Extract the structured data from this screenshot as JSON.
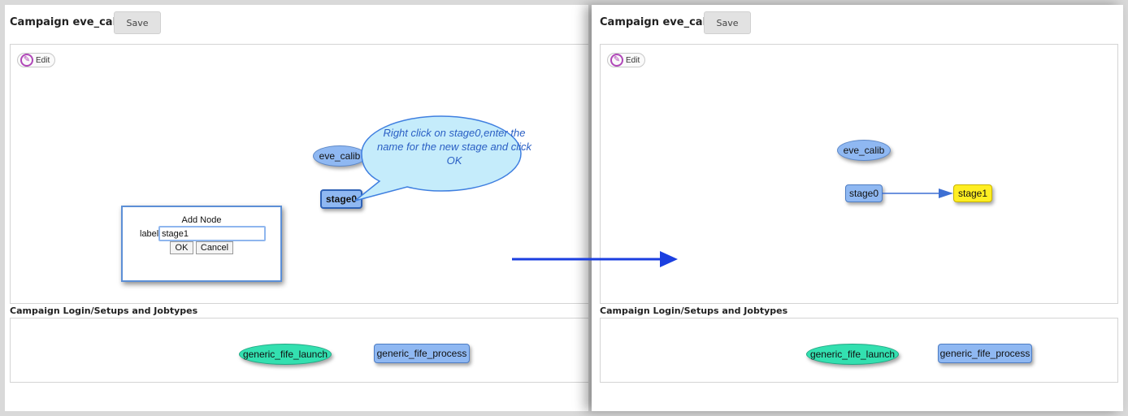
{
  "left": {
    "title": "Campaign eve_calib",
    "save_label": "Save",
    "edit_label": "Edit",
    "nodes": {
      "eve_calib": "eve_calib",
      "stage0": "stage0"
    },
    "callout": "Right click on stage0,enter the name for the new stage and click OK",
    "dialog": {
      "title": "Add Node",
      "label": "label",
      "input_value": "stage1",
      "ok_label": "OK",
      "cancel_label": "Cancel"
    },
    "section_title": "Campaign Login/Setups and Jobtypes",
    "jobtypes": {
      "launch": "generic_fife_launch",
      "process": "generic_fife_process"
    }
  },
  "right": {
    "title": "Campaign eve_calib",
    "save_label": "Save",
    "edit_label": "Edit",
    "nodes": {
      "eve_calib": "eve_calib",
      "stage0": "stage0",
      "stage1": "stage1"
    },
    "section_title": "Campaign Login/Setups and Jobtypes",
    "jobtypes": {
      "launch": "generic_fife_launch",
      "process": "generic_fife_process"
    }
  },
  "colors": {
    "node_blue": "#8fb8f2",
    "node_yellow": "#ffee22",
    "node_teal": "#33e0b0",
    "callout_fill": "#c5ecfb",
    "flow_arrow": "#1b3fe0",
    "edge": "#3d6fd3",
    "edit_icon": "#b047b8"
  },
  "icons": {
    "edit": "pencil-icon"
  }
}
